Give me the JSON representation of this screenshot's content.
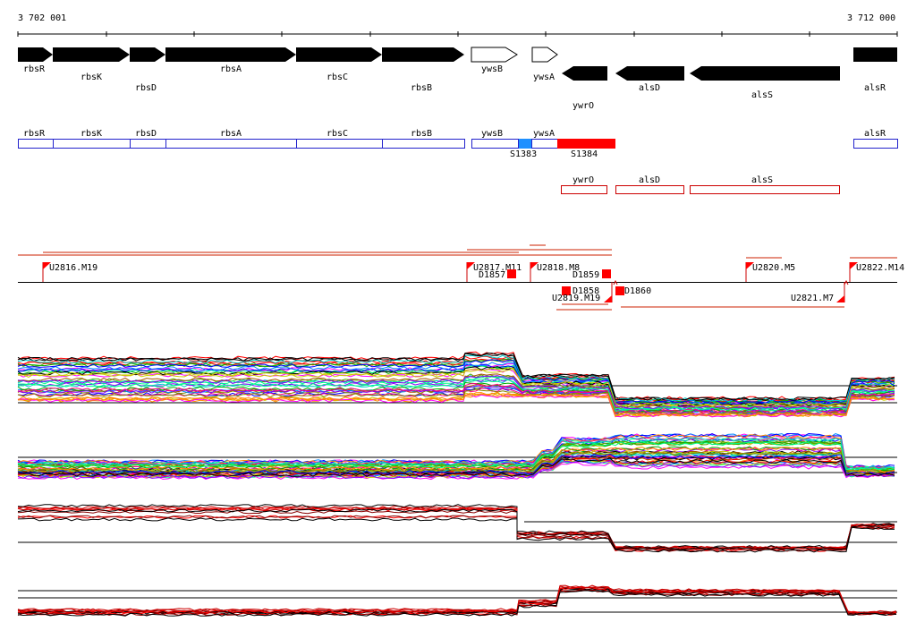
{
  "coords": {
    "start": "3 702 001",
    "end": "3 712 000"
  },
  "genes_top": [
    {
      "name": "rbsR",
      "dir": "right",
      "fill": "#000000"
    },
    {
      "name": "rbsK",
      "dir": "right",
      "fill": "#000000"
    },
    {
      "name": "rbsD",
      "dir": "right",
      "fill": "#000000"
    },
    {
      "name": "rbsA",
      "dir": "right",
      "fill": "#000000"
    },
    {
      "name": "rbsC",
      "dir": "right",
      "fill": "#000000"
    },
    {
      "name": "rbsB",
      "dir": "right",
      "fill": "#000000"
    },
    {
      "name": "ywsB",
      "dir": "right",
      "fill": "#ffffff"
    },
    {
      "name": "ywsA",
      "dir": "right",
      "fill": "#ffffff"
    },
    {
      "name": "ywrO",
      "dir": "left",
      "fill": "#000000"
    },
    {
      "name": "alsD",
      "dir": "left",
      "fill": "#000000"
    },
    {
      "name": "alsS",
      "dir": "left",
      "fill": "#000000"
    },
    {
      "name": "alsR",
      "dir": "left",
      "fill": "#000000"
    }
  ],
  "blue_boxes": [
    "rbsR",
    "rbsK",
    "rbsD",
    "rbsA",
    "rbsC",
    "rbsB",
    "ywsB",
    "ywsA",
    "alsR"
  ],
  "blue_box_color": "#2222cc",
  "red_boxes": [
    "ywrO",
    "alsD",
    "alsS"
  ],
  "red_box_color": "#cc0000",
  "features": [
    {
      "label": "S1383",
      "color": "#1e90ff"
    },
    {
      "label": "S1384",
      "color": "#ff0000"
    }
  ],
  "upstream_sites": [
    "U2816.M19",
    "U2817.M11",
    "U2818.M8",
    "U2820.M5",
    "U2822.M14"
  ],
  "downstream_sites": [
    "D1857",
    "D1859",
    "D1858",
    "D1860"
  ],
  "reverse_sites": [
    "U2819.M19",
    "U2821.M7"
  ],
  "marker_color": "#ff0000"
}
